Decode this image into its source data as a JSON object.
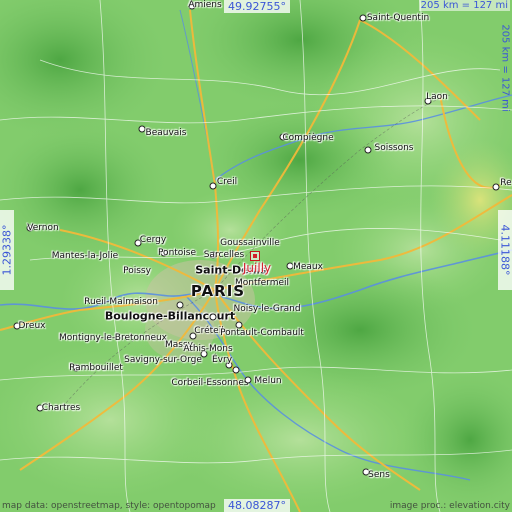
{
  "coords": {
    "top": "49.92755°",
    "bottom": "48.08287°",
    "left": "1.29338°",
    "right": "4.11188°"
  },
  "scale": {
    "horizontal": "205 km = 127 mi",
    "vertical": "205 km = 127 mi"
  },
  "attribution": {
    "left": "map data: openstreetmap, style: opentopomap",
    "right": "image proc.: elevation.city"
  },
  "target": "Juilly",
  "cities": [
    {
      "name": "Amiens",
      "size": "normal"
    },
    {
      "name": "Saint-Quentin",
      "size": "normal"
    },
    {
      "name": "Laon",
      "size": "normal"
    },
    {
      "name": "Soissons",
      "size": "normal"
    },
    {
      "name": "Compiègne",
      "size": "normal"
    },
    {
      "name": "Beauvais",
      "size": "normal"
    },
    {
      "name": "Creil",
      "size": "normal"
    },
    {
      "name": "Vernon",
      "size": "normal"
    },
    {
      "name": "Cergy",
      "size": "normal"
    },
    {
      "name": "Pontoise",
      "size": "normal"
    },
    {
      "name": "Mantes-la-Jolie",
      "size": "normal"
    },
    {
      "name": "Poissy",
      "size": "normal"
    },
    {
      "name": "Sarcelles",
      "size": "normal"
    },
    {
      "name": "Goussainville",
      "size": "normal"
    },
    {
      "name": "Saint-Denis",
      "size": "big"
    },
    {
      "name": "Meaux",
      "size": "normal"
    },
    {
      "name": "Montfermeil",
      "size": "normal"
    },
    {
      "name": "PARIS",
      "size": "paris"
    },
    {
      "name": "Rueil-Malmaison",
      "size": "normal"
    },
    {
      "name": "Boulogne-Billancourt",
      "size": "big"
    },
    {
      "name": "Noisy-le-Grand",
      "size": "normal"
    },
    {
      "name": "Dreux",
      "size": "normal"
    },
    {
      "name": "Montigny-le-Bretonneux",
      "size": "normal"
    },
    {
      "name": "Massy",
      "size": "normal"
    },
    {
      "name": "Créteil",
      "size": "normal"
    },
    {
      "name": "Pontault-Combault",
      "size": "normal"
    },
    {
      "name": "Savigny-sur-Orge",
      "size": "normal"
    },
    {
      "name": "Athis-Mons",
      "size": "normal"
    },
    {
      "name": "Évry",
      "size": "normal"
    },
    {
      "name": "Rambouillet",
      "size": "normal"
    },
    {
      "name": "Corbeil-Essonnes",
      "size": "normal"
    },
    {
      "name": "Melun",
      "size": "normal"
    },
    {
      "name": "Chartres",
      "size": "normal"
    },
    {
      "name": "Sens",
      "size": "normal"
    },
    {
      "name": "Re",
      "size": "normal"
    }
  ],
  "colors": {
    "lowland": "#8fd476",
    "hill": "#5fb84f",
    "forest": "#4aa640",
    "road_major": "#f2b93a",
    "road_minor": "#ffffff",
    "river": "#5a8fe0",
    "urban": "#c9c4a8",
    "coord_text": "#3b56d6",
    "target_marker": "#d2202a"
  }
}
